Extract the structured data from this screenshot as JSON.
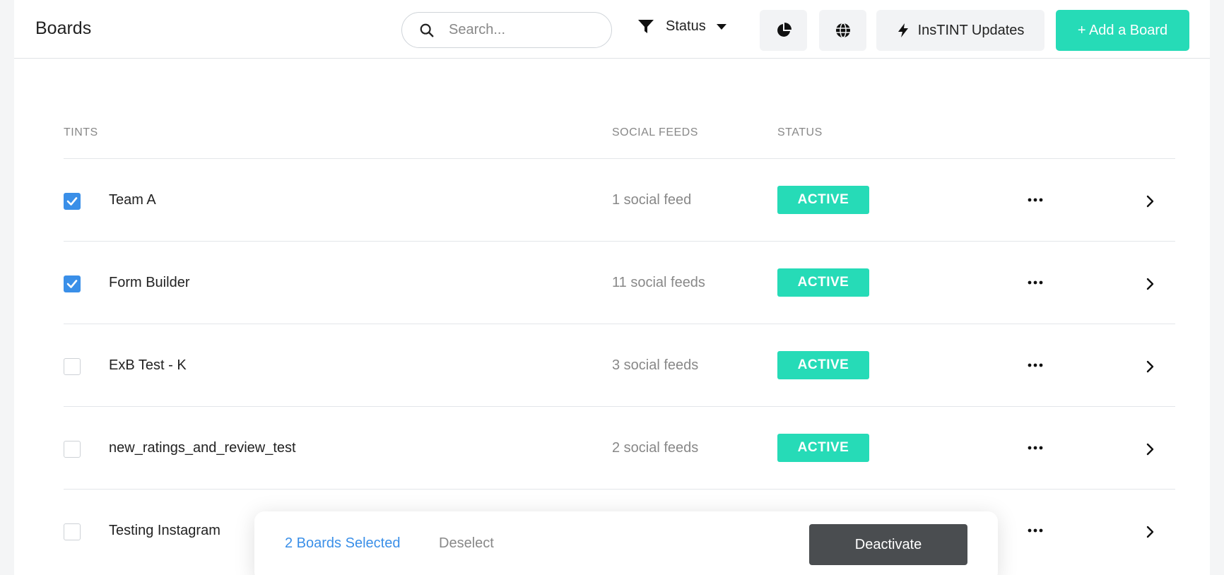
{
  "header": {
    "title": "Boards",
    "search_placeholder": "Search...",
    "status_filter_label": "Status",
    "updates_label": "InsTINT Updates",
    "add_board_label": "+ Add a Board"
  },
  "table": {
    "columns": {
      "tints": "TINTS",
      "social_feeds": "SOCIAL FEEDS",
      "status": "STATUS"
    },
    "rows": [
      {
        "name": "Team A",
        "feeds": "1 social feed",
        "status": "ACTIVE",
        "checked": true
      },
      {
        "name": "Form Builder",
        "feeds": "11 social feeds",
        "status": "ACTIVE",
        "checked": true
      },
      {
        "name": "ExB Test - K",
        "feeds": "3 social feeds",
        "status": "ACTIVE",
        "checked": false
      },
      {
        "name": "new_ratings_and_review_test",
        "feeds": "2 social feeds",
        "status": "ACTIVE",
        "checked": false
      },
      {
        "name": "Testing Instagram",
        "feeds": "",
        "status": "",
        "checked": false
      }
    ]
  },
  "selection_bar": {
    "count_label": "2 Boards Selected",
    "deselect_label": "Deselect",
    "deactivate_label": "Deactivate"
  },
  "colors": {
    "accent": "#26dbb7",
    "checkbox": "#3a8fe8",
    "deactivate": "#4a4d50"
  },
  "icons": {
    "search": "search-icon",
    "filter": "funnel-icon",
    "analytics": "pie-chart-icon",
    "globe": "globe-icon",
    "updates": "lightning-icon",
    "more": "more-dots-icon",
    "chevron": "chevron-right-icon"
  }
}
